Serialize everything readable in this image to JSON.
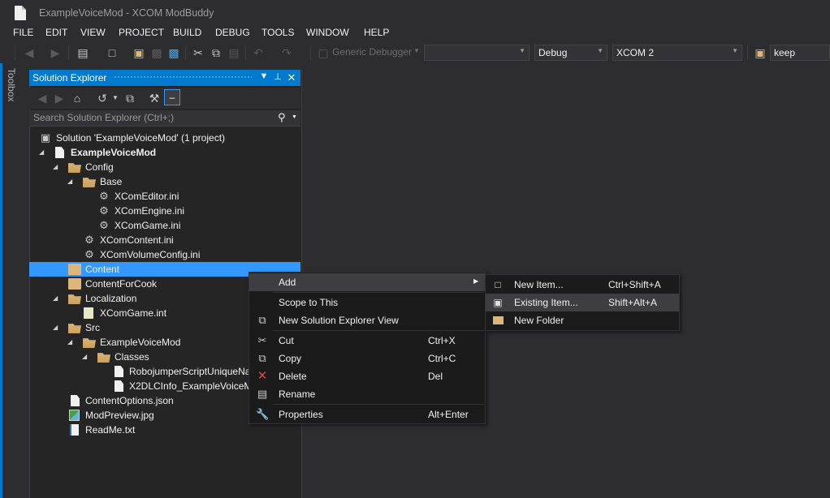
{
  "window": {
    "title": "ExampleVoiceMod - XCOM ModBuddy"
  },
  "menubar": {
    "items": [
      "FILE",
      "EDIT",
      "VIEW",
      "PROJECT",
      "BUILD",
      "DEBUG",
      "TOOLS",
      "WINDOW",
      "HELP"
    ]
  },
  "toolbar": {
    "debugger_label": "Generic Debugger",
    "empty_combo": "",
    "config_combo": "Debug",
    "platform_combo": "XCOM 2",
    "find_value": "keep"
  },
  "toolbox": {
    "label": "Toolbox"
  },
  "solution_explorer": {
    "title": "Solution Explorer",
    "search_placeholder": "Search Solution Explorer (Ctrl+;)",
    "tree": {
      "solution": "Solution 'ExampleVoiceMod' (1 project)",
      "project": "ExampleVoiceMod",
      "config": "Config",
      "base": "Base",
      "xcomeditor": "XComEditor.ini",
      "xcomengine": "XComEngine.ini",
      "xcomgame_ini": "XComGame.ini",
      "xcomcontent": "XComContent.ini",
      "xcomvolume": "XComVolumeConfig.ini",
      "content": "Content",
      "contentforcook": "ContentForCook",
      "localization": "Localization",
      "xcomgame_int": "XComGame.int",
      "src": "Src",
      "src_project": "ExampleVoiceMod",
      "classes": "Classes",
      "robojumper": "RobojumperScriptUniqueNa",
      "x2dlc": "X2DLCInfo_ExampleVoiceMo",
      "contentoptions": "ContentOptions.json",
      "modpreview": "ModPreview.jpg",
      "readme": "ReadMe.txt"
    }
  },
  "context_menu": {
    "add": "Add",
    "scope": "Scope to This",
    "new_view": "New Solution Explorer View",
    "cut": "Cut",
    "cut_key": "Ctrl+X",
    "copy": "Copy",
    "copy_key": "Ctrl+C",
    "delete": "Delete",
    "delete_key": "Del",
    "rename": "Rename",
    "properties": "Properties",
    "properties_key": "Alt+Enter"
  },
  "submenu": {
    "new_item": "New Item...",
    "new_item_key": "Ctrl+Shift+A",
    "existing_item": "Existing Item...",
    "existing_item_key": "Shift+Alt+A",
    "new_folder": "New Folder"
  },
  "colors": {
    "accent": "#007acc",
    "selection": "#3399ff",
    "background": "#2d2d30"
  }
}
